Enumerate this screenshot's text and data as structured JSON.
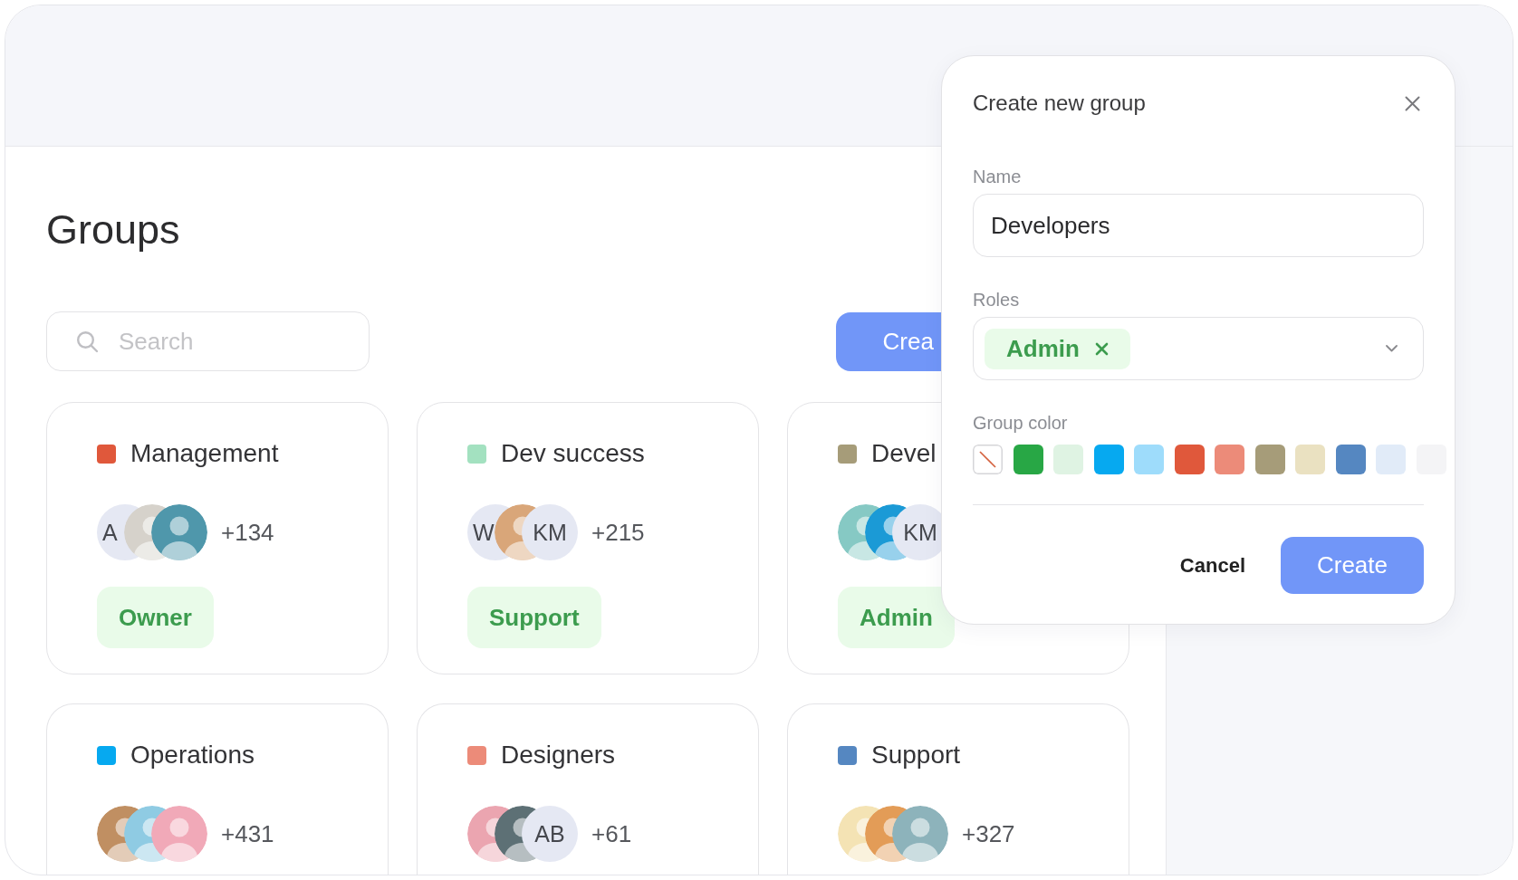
{
  "page": {
    "title": "Groups",
    "search": {
      "placeholder": "Search"
    },
    "create_button": "Crea"
  },
  "groups": [
    {
      "name": "Management",
      "color": "#e0583b",
      "avatars": [
        {
          "kind": "initials",
          "text": "A"
        },
        {
          "kind": "photo"
        },
        {
          "kind": "photo"
        }
      ],
      "members": "+134",
      "role": "Owner"
    },
    {
      "name": "Dev success",
      "color": "#a3e1c0",
      "avatars": [
        {
          "kind": "initials",
          "text": "W"
        },
        {
          "kind": "photo"
        },
        {
          "kind": "initials",
          "text": "KM"
        }
      ],
      "members": "+215",
      "role": "Support"
    },
    {
      "name": "Devel",
      "color": "#a69c79",
      "avatars": [
        {
          "kind": "photo"
        },
        {
          "kind": "photo"
        },
        {
          "kind": "initials",
          "text": "KM"
        }
      ],
      "role": "Admin"
    },
    {
      "name": "Operations",
      "color": "#06a9f0",
      "avatars": [
        {
          "kind": "photo"
        },
        {
          "kind": "photo"
        },
        {
          "kind": "photo"
        }
      ],
      "members": "+431"
    },
    {
      "name": "Designers",
      "color": "#ec8b79",
      "avatars": [
        {
          "kind": "photo"
        },
        {
          "kind": "photo"
        },
        {
          "kind": "initials",
          "text": "AB"
        }
      ],
      "members": "+61"
    },
    {
      "name": "Support",
      "color": "#5587c1",
      "avatars": [
        {
          "kind": "photo"
        },
        {
          "kind": "photo"
        },
        {
          "kind": "photo"
        }
      ],
      "members": "+327"
    }
  ],
  "dialog": {
    "title": "Create new group",
    "name_label": "Name",
    "name_value": "Developers",
    "roles_label": "Roles",
    "roles": [
      "Admin"
    ],
    "color_label": "Group color",
    "colors": [
      {
        "kind": "none"
      },
      {
        "kind": "color",
        "color": "#28a745"
      },
      {
        "kind": "color",
        "color": "#dff3e3"
      },
      {
        "kind": "color",
        "color": "#06a9f0"
      },
      {
        "kind": "color",
        "color": "#9edcfb"
      },
      {
        "kind": "color",
        "color": "#e0583b"
      },
      {
        "kind": "color",
        "color": "#ec8b79"
      },
      {
        "kind": "color",
        "color": "#a69c79"
      },
      {
        "kind": "color",
        "color": "#eae1c1"
      },
      {
        "kind": "color",
        "color": "#5587c1"
      },
      {
        "kind": "color",
        "color": "#e1ebf8"
      },
      {
        "kind": "color",
        "color": "#f4f4f6"
      }
    ],
    "buttons": [
      {
        "kind": "text",
        "label": "Cancel"
      },
      {
        "kind": "primary",
        "label": "Create"
      }
    ]
  }
}
